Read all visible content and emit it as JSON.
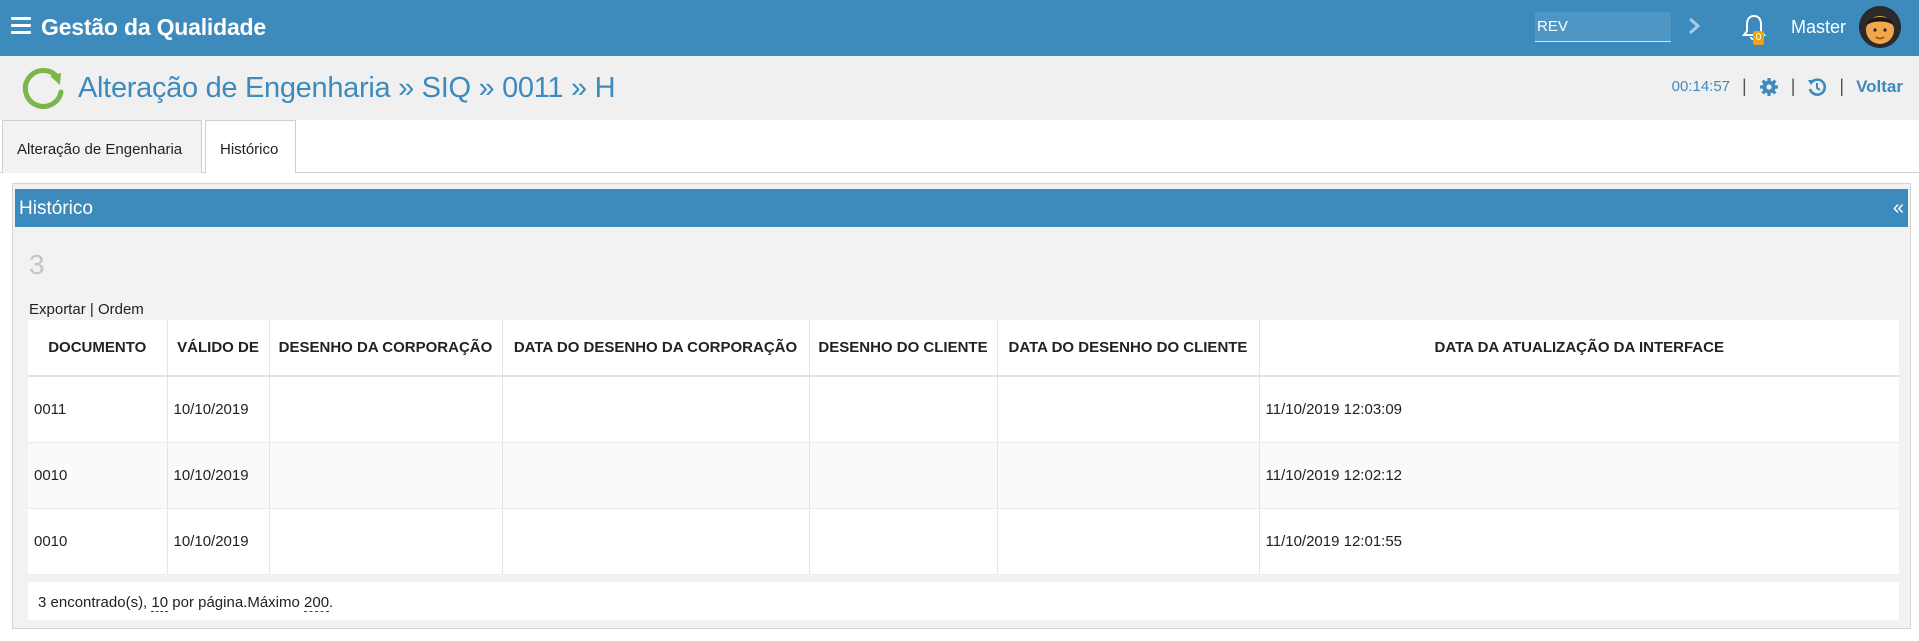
{
  "app": {
    "title": "Gestão da Qualidade",
    "search_value": "REV",
    "notifications_count": "0",
    "user_name": "Master"
  },
  "header": {
    "title": "Alteração de Engenharia » SIQ » 0011 » H",
    "timer": "00:14:57",
    "separator": "|",
    "back_label": "Voltar"
  },
  "tabs": [
    {
      "label": "Alteração de Engenharia",
      "active": false
    },
    {
      "label": "Histórico",
      "active": true
    }
  ],
  "panel": {
    "title": "Histórico",
    "collapse_symbol": "«",
    "count": "3",
    "actions": {
      "export": "Exportar",
      "separator": "|",
      "order": "Ordem"
    }
  },
  "table": {
    "columns": [
      "DOCUMENTO",
      "VÁLIDO DE",
      "DESENHO DA CORPORAÇÃO",
      "DATA DO DESENHO DA CORPORAÇÃO",
      "DESENHO DO CLIENTE",
      "DATA DO DESENHO DO CLIENTE",
      "DATA DA ATUALIZAÇÃO DA INTERFACE"
    ],
    "rows": [
      [
        "0011",
        "10/10/2019",
        "",
        "",
        "",
        "",
        "11/10/2019 12:03:09"
      ],
      [
        "0010",
        "10/10/2019",
        "",
        "",
        "",
        "",
        "11/10/2019 12:02:12"
      ],
      [
        "0010",
        "10/10/2019",
        "",
        "",
        "",
        "",
        "11/10/2019 12:01:55"
      ]
    ]
  },
  "pager": {
    "found": "3 encontrado(s),",
    "per_page_value": "10",
    "per_page_label": "por página.Máximo",
    "max_value": "200",
    "end": "."
  },
  "colors": {
    "primary": "#3d8bbd",
    "logo_green": "#7ab648",
    "badge": "#e8a317"
  },
  "icons": {
    "menu": "hamburger-icon",
    "search_go": "chevron-right-icon",
    "notifications": "bell-icon",
    "logo": "refresh-icon",
    "settings": "gear-icon",
    "history": "history-icon"
  }
}
